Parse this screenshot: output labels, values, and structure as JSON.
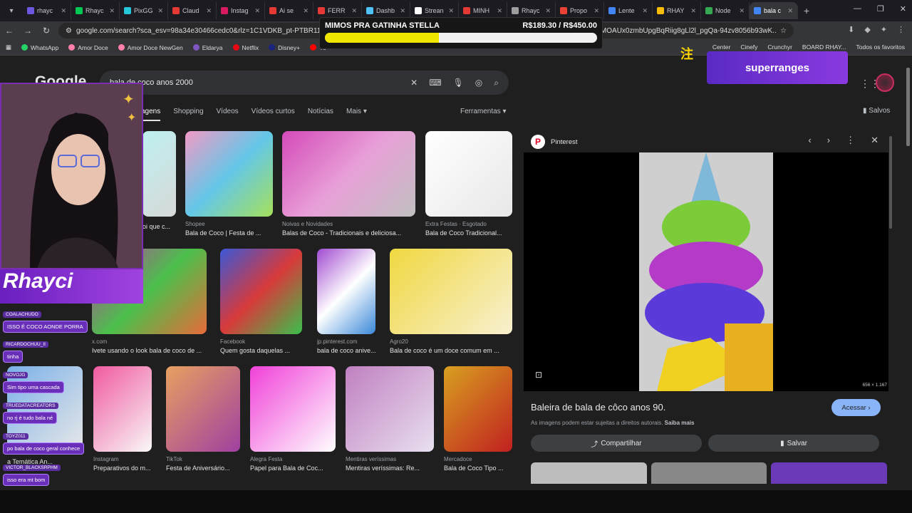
{
  "tabs": [
    {
      "label": "rhayc",
      "color": "#6b57e0"
    },
    {
      "label": "Rhayc",
      "color": "#00c853"
    },
    {
      "label": "PixGG",
      "color": "#26c6da"
    },
    {
      "label": "Claud",
      "color": "#e53935"
    },
    {
      "label": "Instag",
      "color": "#d81b60"
    },
    {
      "label": "Ai se",
      "color": "#e53935"
    },
    {
      "label": "FERR",
      "color": "#e53935"
    },
    {
      "label": "Dashb",
      "color": "#4fc3f7"
    },
    {
      "label": "Strean",
      "color": "#ffffff"
    },
    {
      "label": "MINH",
      "color": "#e53935"
    },
    {
      "label": "Rhayc",
      "color": "#9e9e9e"
    },
    {
      "label": "Propo",
      "color": "#ea4335"
    },
    {
      "label": "Lente",
      "color": "#4285f4"
    },
    {
      "label": "RHAY",
      "color": "#fbbc04"
    },
    {
      "label": "Node",
      "color": "#34a853"
    },
    {
      "label": "bala c",
      "color": "#4285f4"
    }
  ],
  "address_bar": {
    "url": "google.com/search?sca_esv=98a34e30466cedc0&rlz=1C1VDKB_pt-PTBR1166BR11",
    "url_tail": "8MMOAUx0zmbUpgBqRiig8gLl2l_pgQa-94zv8056b93wK..."
  },
  "bookmarks": [
    {
      "label": "WhatsApp",
      "color": "#25d366"
    },
    {
      "label": "Amor Doce",
      "color": "#ff80ab"
    },
    {
      "label": "Amor Doce NewGen",
      "color": "#ff80ab"
    },
    {
      "label": "Eldarya",
      "color": "#7e57c2"
    },
    {
      "label": "Netflix",
      "color": "#e50914"
    },
    {
      "label": "Disney+",
      "color": "#1a237e"
    },
    {
      "label": "Yo",
      "color": "#ff0000"
    }
  ],
  "bookmarks_right": [
    {
      "label": "Center"
    },
    {
      "label": "Cinefy"
    },
    {
      "label": "Crunchyr"
    },
    {
      "label": "BOARD RHAY..."
    },
    {
      "label": "Todos os favoritos"
    }
  ],
  "google": {
    "logo": "Google",
    "query": "bala de coco anos 2000",
    "tabs": [
      "agens",
      "Shopping",
      "Vídeos",
      "Vídeos curtos",
      "Notícias",
      "Mais"
    ],
    "tools": "Ferramentas",
    "saved": "Salvos"
  },
  "results": [
    {
      "src": "",
      "title": "oi que c...",
      "colors": [
        "#bdf0f0",
        "#d8d8d8"
      ]
    },
    {
      "src": "Shopee",
      "title": "Bala de Coco | Festa de ...",
      "colors": [
        "#f29ac6",
        "#63c7e8",
        "#a6e05a"
      ]
    },
    {
      "src": "Noivas e Novidades",
      "title": "Balas de Coco - Tradicionais e deliciosa...",
      "colors": [
        "#d44ab8",
        "#e8a0d8",
        "#c0c0c0"
      ]
    },
    {
      "src": "Extra Festas · Esgotado",
      "title": "Bala de Coco Tradicional...",
      "colors": [
        "#ffffff",
        "#e8e8e8"
      ]
    },
    {
      "src": "x.com",
      "title": "Ivete usando o look bala de coco de ...",
      "colors": [
        "#c03aa8",
        "#4bc04b",
        "#e86a3a"
      ]
    },
    {
      "src": "Facebook",
      "title": "Quem gosta daquelas ...",
      "colors": [
        "#3a58d8",
        "#d83a3a",
        "#3ac04b"
      ]
    },
    {
      "src": "jp.pinterest.com",
      "title": "bala de coco anive...",
      "colors": [
        "#a04ad0",
        "#ffffff",
        "#3a88d8"
      ]
    },
    {
      "src": "Agro20",
      "title": "Bala de coco é um doce comum em ...",
      "colors": [
        "#f0d840",
        "#f8f0d0"
      ]
    },
    {
      "src": "",
      "title": "a Temática An...",
      "colors": [
        "#7ab0e8",
        "#e8e8e8"
      ]
    },
    {
      "src": "Instagram",
      "title": "Preparativos do m...",
      "colors": [
        "#f05aa0",
        "#f8f8f8"
      ]
    },
    {
      "src": "TikTok",
      "title": "Festa de Aniversário...",
      "colors": [
        "#e8a060",
        "#a040a0"
      ]
    },
    {
      "src": "Alegra Festa",
      "title": "Papel para Bala de Coc...",
      "colors": [
        "#f040d8",
        "#ffffff"
      ]
    },
    {
      "src": "Mentiras veríssimas",
      "title": "Mentiras veríssimas: Re...",
      "colors": [
        "#c080c0",
        "#e8e0f0"
      ]
    },
    {
      "src": "Mercadoce",
      "title": "Bala de Coco Tipo ...",
      "colors": [
        "#d8a020",
        "#c02020"
      ]
    }
  ],
  "preview": {
    "source": "Pinterest",
    "title": "Baleira de bala de côco anos 90.",
    "visit_label": "Acessar",
    "copyright": "As imagens podem estar sujeitas a direitos autorais.",
    "learn_more": "Saiba mais",
    "share_label": "Compartilhar",
    "save_label": "Salvar",
    "dimensions": "656 × 1.167"
  },
  "stream": {
    "donation_title": "MIMOS PRA GATINHA STELLA",
    "donation_amount": "R$189.30 / R$450.00",
    "donation_progress": 0.42,
    "brand": "Rhayci",
    "command": "superranges",
    "deco": "注",
    "chat": [
      {
        "user": "COALACHUDO",
        "msg": "ISSO É COCO AONDE PORRA"
      },
      {
        "user": "RICARDOCHUU_II",
        "msg": "tinha"
      },
      {
        "user": "NOVOJG",
        "msg": "Sim tipo uma cascada"
      },
      {
        "user": "TRUEDATACREATORS",
        "msg": "no rj é tudo bala né"
      },
      {
        "user": "TOYZ011",
        "msg": "po bala de coco geral conhece"
      },
      {
        "user": "VICTOR_BLACKSRPHM",
        "msg": "isso era mt bom"
      }
    ]
  }
}
